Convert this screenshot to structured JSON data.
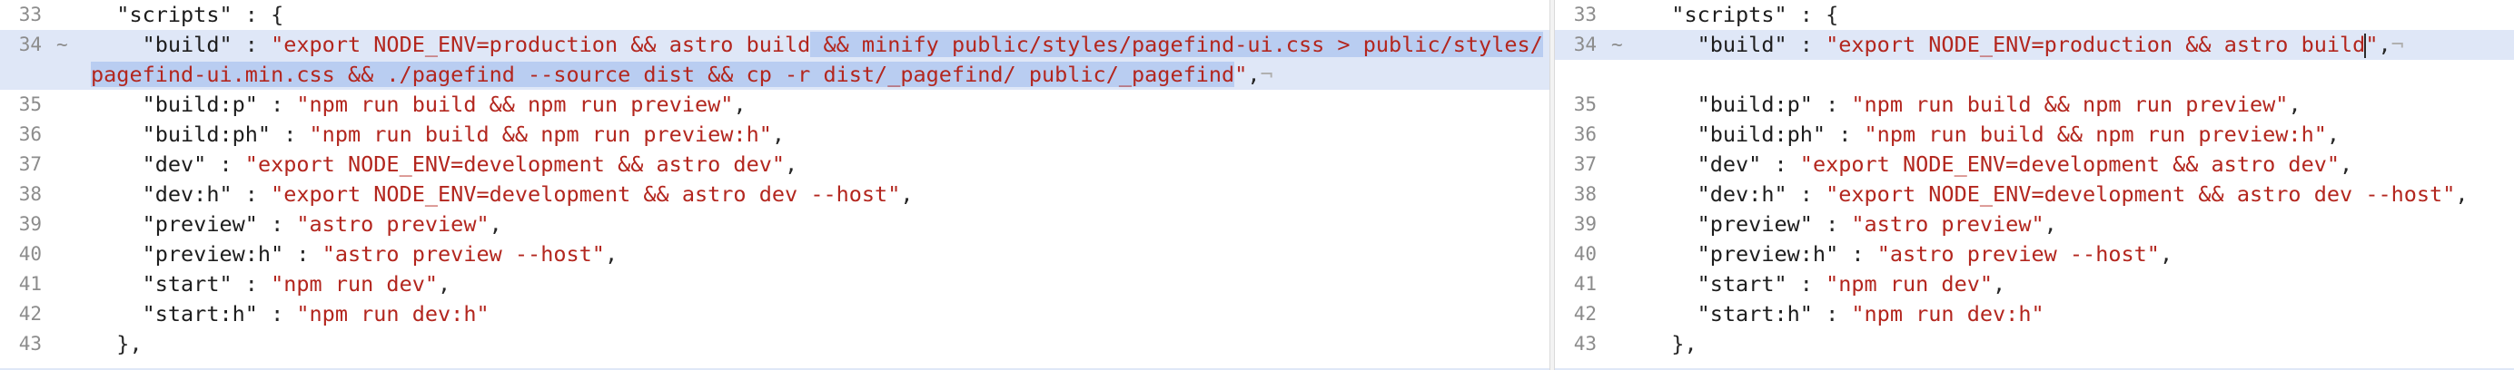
{
  "left": {
    "lines": [
      {
        "num": "33",
        "indent": "  ",
        "key": "\"scripts\"",
        "sep": " : ",
        "open": "{"
      },
      {
        "num": "34",
        "marker": "~",
        "indent": "    ",
        "key": "\"build\"",
        "sep": " : ",
        "str_a": "\"export NODE_ENV=production && astro build",
        "str_hl": " && minify public/styles/pagefind-ui.css > public/styles/",
        "cont_hl": "pagefind-ui.min.css && ./pagefind --source dist && cp -r dist/_pagefind/ public/_pagefind",
        "cont_tail": "\"",
        "comma": ",",
        "eol": "¬"
      },
      {
        "num": "35",
        "indent": "    ",
        "key": "\"build:p\"",
        "sep": " : ",
        "str": "\"npm run build && npm run preview\"",
        "comma": ","
      },
      {
        "num": "36",
        "indent": "    ",
        "key": "\"build:ph\"",
        "sep": " : ",
        "str": "\"npm run build && npm run preview:h\"",
        "comma": ","
      },
      {
        "num": "37",
        "indent": "    ",
        "key": "\"dev\"",
        "sep": " : ",
        "str": "\"export NODE_ENV=development && astro dev\"",
        "comma": ","
      },
      {
        "num": "38",
        "indent": "    ",
        "key": "\"dev:h\"",
        "sep": " : ",
        "str": "\"export NODE_ENV=development && astro dev --host\"",
        "comma": ","
      },
      {
        "num": "39",
        "indent": "    ",
        "key": "\"preview\"",
        "sep": " : ",
        "str": "\"astro preview\"",
        "comma": ","
      },
      {
        "num": "40",
        "indent": "    ",
        "key": "\"preview:h\"",
        "sep": " : ",
        "str": "\"astro preview --host\"",
        "comma": ","
      },
      {
        "num": "41",
        "indent": "    ",
        "key": "\"start\"",
        "sep": " : ",
        "str": "\"npm run dev\"",
        "comma": ","
      },
      {
        "num": "42",
        "indent": "    ",
        "key": "\"start:h\"",
        "sep": " : ",
        "str": "\"npm run dev:h\"",
        "comma": ""
      },
      {
        "num": "43",
        "indent": "  ",
        "close": "},"
      }
    ]
  },
  "right": {
    "lines": [
      {
        "num": "33",
        "indent": "  ",
        "key": "\"scripts\"",
        "sep": " : ",
        "open": "{"
      },
      {
        "num": "34",
        "marker": "~",
        "indent": "    ",
        "key": "\"build\"",
        "sep": " : ",
        "str_a": "\"export NODE_ENV=production && astro build",
        "str_end": "\"",
        "comma": ",",
        "eol": "¬"
      },
      {
        "num": "35",
        "indent": "    ",
        "key": "\"build:p\"",
        "sep": " : ",
        "str": "\"npm run build && npm run preview\"",
        "comma": ","
      },
      {
        "num": "36",
        "indent": "    ",
        "key": "\"build:ph\"",
        "sep": " : ",
        "str": "\"npm run build && npm run preview:h\"",
        "comma": ","
      },
      {
        "num": "37",
        "indent": "    ",
        "key": "\"dev\"",
        "sep": " : ",
        "str": "\"export NODE_ENV=development && astro dev\"",
        "comma": ","
      },
      {
        "num": "38",
        "indent": "    ",
        "key": "\"dev:h\"",
        "sep": " : ",
        "str": "\"export NODE_ENV=development && astro dev --host\"",
        "comma": ","
      },
      {
        "num": "39",
        "indent": "    ",
        "key": "\"preview\"",
        "sep": " : ",
        "str": "\"astro preview\"",
        "comma": ","
      },
      {
        "num": "40",
        "indent": "    ",
        "key": "\"preview:h\"",
        "sep": " : ",
        "str": "\"astro preview --host\"",
        "comma": ","
      },
      {
        "num": "41",
        "indent": "    ",
        "key": "\"start\"",
        "sep": " : ",
        "str": "\"npm run dev\"",
        "comma": ","
      },
      {
        "num": "42",
        "indent": "    ",
        "key": "\"start:h\"",
        "sep": " : ",
        "str": "\"npm run dev:h\"",
        "comma": ""
      },
      {
        "num": "43",
        "indent": "  ",
        "close": "},"
      }
    ]
  },
  "colors": {
    "string": "#b3261e",
    "change_background": "#dfe7f7",
    "change_highlight": "#b9cdf1",
    "line_number": "#8c8c8c"
  }
}
